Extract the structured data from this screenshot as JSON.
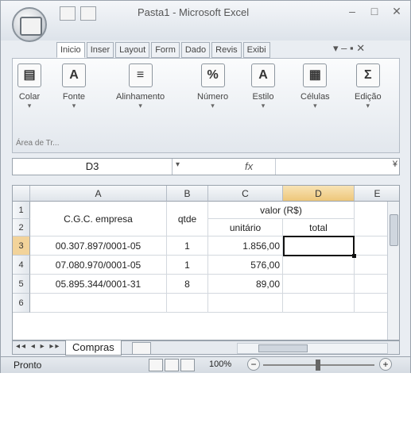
{
  "window": {
    "title": "Pasta1 - Microsoft Excel"
  },
  "tabs": [
    {
      "label": "Inicio",
      "active": true
    },
    {
      "label": "Inser"
    },
    {
      "label": "Layout"
    },
    {
      "label": "Form"
    },
    {
      "label": "Dado"
    },
    {
      "label": "Revis"
    },
    {
      "label": "Exibi"
    }
  ],
  "ribbon": {
    "groups": [
      {
        "label": "Colar",
        "icon": "paste-icon"
      },
      {
        "label": "Fonte",
        "icon": "font-icon"
      },
      {
        "label": "Alinhamento",
        "icon": "align-icon"
      },
      {
        "label": "Número",
        "icon": "percent-icon"
      },
      {
        "label": "Estilo",
        "icon": "style-icon"
      },
      {
        "label": "Células",
        "icon": "cells-icon"
      },
      {
        "label": "Edição",
        "icon": "sigma-icon"
      }
    ],
    "clipboard_label": "Área de Tr..."
  },
  "formula_bar": {
    "name_box": "D3",
    "fx": "fx",
    "value": ""
  },
  "grid": {
    "columns": [
      "A",
      "B",
      "C",
      "D",
      "E"
    ],
    "rows": [
      "1",
      "2",
      "3",
      "4",
      "5",
      "6"
    ],
    "selected_column": "D",
    "selected_row": "3",
    "header_A": "C.G.C. empresa",
    "header_B": "qtde",
    "header_C_main": "valor (R$)",
    "header_C_sub": "unitário",
    "header_D_sub": "total",
    "data": [
      {
        "cgc": "00.307.897/0001-05",
        "qtde": "1",
        "unit": "1.856,00"
      },
      {
        "cgc": "07.080.970/0001-05",
        "qtde": "1",
        "unit": "576,00"
      },
      {
        "cgc": "05.895.344/0001-31",
        "qtde": "8",
        "unit": "89,00"
      }
    ]
  },
  "sheet": {
    "tab_label": "Compras"
  },
  "status": {
    "text": "Pronto",
    "zoom": "100%"
  }
}
